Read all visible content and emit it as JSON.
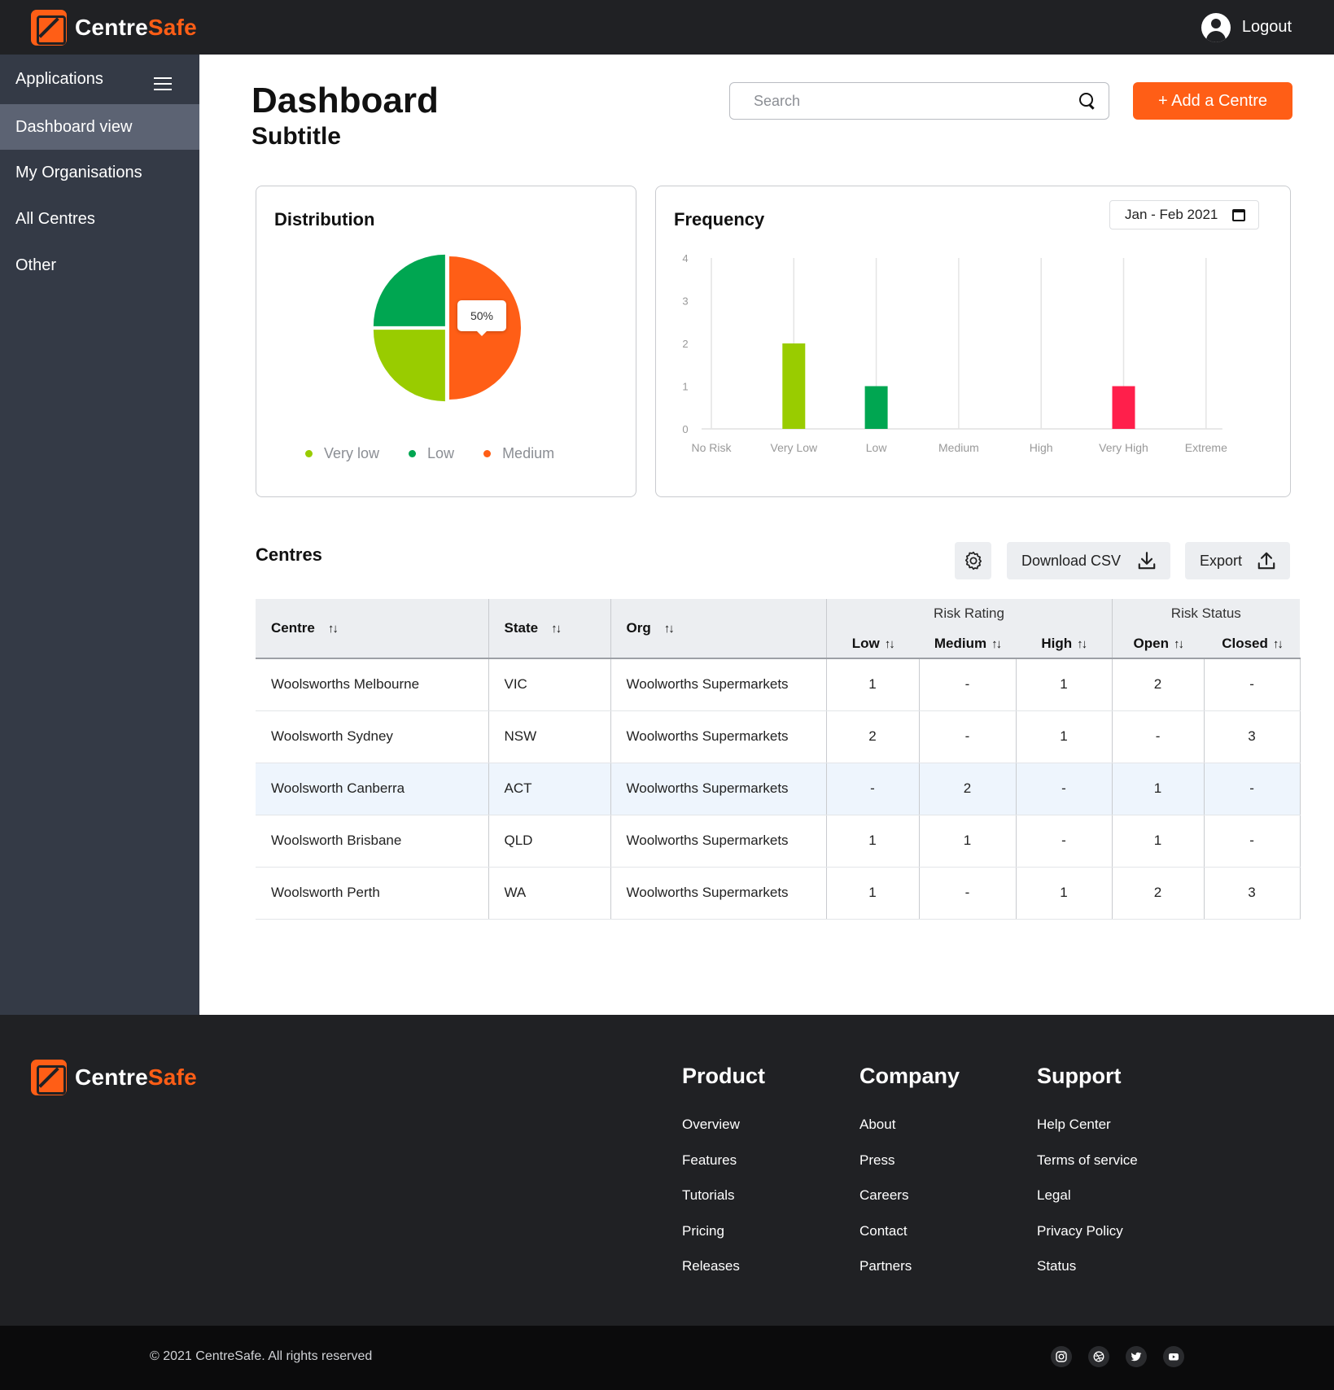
{
  "brand": {
    "name_part1": "Centre",
    "name_part2": "Safe",
    "accent_color": "#ff5e16"
  },
  "header": {
    "logout_label": "Logout",
    "user_icon": "user-circle-icon"
  },
  "sidebar": {
    "title": "Applications",
    "menu_icon": "hamburger-icon",
    "items": [
      {
        "label": "Dashboard view",
        "active": true
      },
      {
        "label": "My Organisations",
        "active": false
      },
      {
        "label": "All Centres",
        "active": false
      },
      {
        "label": "Other",
        "active": false
      }
    ]
  },
  "main": {
    "title": "Dashboard",
    "subtitle": "Subtitle",
    "search": {
      "placeholder": "Search",
      "value": ""
    },
    "add_button": "+ Add a Centre"
  },
  "distribution": {
    "title": "Distribution",
    "tooltip": "50%",
    "legend": [
      {
        "label": "Very low",
        "color": "#99cc00"
      },
      {
        "label": "Low",
        "color": "#00a651"
      },
      {
        "label": "Medium",
        "color": "#ff5e16"
      }
    ]
  },
  "frequency": {
    "title": "Frequency",
    "date_range": "Jan - Feb 2021"
  },
  "chart_data": [
    {
      "type": "pie",
      "title": "Distribution",
      "categories": [
        "Medium",
        "Very low",
        "Low"
      ],
      "values": [
        50,
        25,
        25
      ],
      "colors": [
        "#ff5e16",
        "#99cc00",
        "#00a651"
      ],
      "legend": "bottom"
    },
    {
      "type": "bar",
      "title": "Frequency",
      "categories": [
        "No Risk",
        "Very Low",
        "Low",
        "Medium",
        "High",
        "Very High",
        "Extreme"
      ],
      "values": [
        0,
        2,
        1,
        0,
        0,
        1,
        0
      ],
      "colors": [
        "#99cc00",
        "#99cc00",
        "#00a651",
        "#cccccc",
        "#cccccc",
        "#ff1f4b",
        "#cccccc"
      ],
      "yticks": [
        0,
        1,
        2,
        3,
        4
      ],
      "ylim": [
        0,
        4
      ],
      "grid": "vertical"
    }
  ],
  "centres": {
    "title": "Centres",
    "settings_icon": "gear-icon",
    "download_label": "Download CSV",
    "export_label": "Export",
    "columns": {
      "centre": "Centre",
      "state": "State",
      "org": "Org",
      "risk_rating": "Risk Rating",
      "risk_status": "Risk Status",
      "low": "Low",
      "medium": "Medium",
      "high": "High",
      "open": "Open",
      "closed": "Closed"
    },
    "rows": [
      {
        "centre": "Woolsworths Melbourne",
        "state": "VIC",
        "org": "Woolworths Supermarkets",
        "low": "1",
        "medium": "-",
        "high": "1",
        "open": "2",
        "closed": "-"
      },
      {
        "centre": "Woolsworth Sydney",
        "state": "NSW",
        "org": "Woolworths Supermarkets",
        "low": "2",
        "medium": "-",
        "high": "1",
        "open": "-",
        "closed": "3"
      },
      {
        "centre": "Woolsworth Canberra",
        "state": "ACT",
        "org": "Woolworths Supermarkets",
        "low": "-",
        "medium": "2",
        "high": "-",
        "open": "1",
        "closed": "-"
      },
      {
        "centre": "Woolsworth Brisbane",
        "state": "QLD",
        "org": "Woolworths Supermarkets",
        "low": "1",
        "medium": "1",
        "high": "-",
        "open": "1",
        "closed": "-"
      },
      {
        "centre": "Woolsworth Perth",
        "state": "WA",
        "org": "Woolworths Supermarkets",
        "low": "1",
        "medium": "-",
        "high": "1",
        "open": "2",
        "closed": "3"
      }
    ]
  },
  "footer": {
    "columns": [
      {
        "title": "Product",
        "links": [
          "Overview",
          "Features",
          "Tutorials",
          "Pricing",
          "Releases"
        ]
      },
      {
        "title": "Company",
        "links": [
          "About",
          "Press",
          "Careers",
          "Contact",
          "Partners"
        ]
      },
      {
        "title": "Support",
        "links": [
          "Help Center",
          "Terms of service",
          "Legal",
          "Privacy Policy",
          "Status"
        ]
      }
    ],
    "copyright": "© 2021 CentreSafe. All rights reserved",
    "socials": [
      "instagram-icon",
      "dribbble-icon",
      "twitter-icon",
      "youtube-icon"
    ]
  }
}
